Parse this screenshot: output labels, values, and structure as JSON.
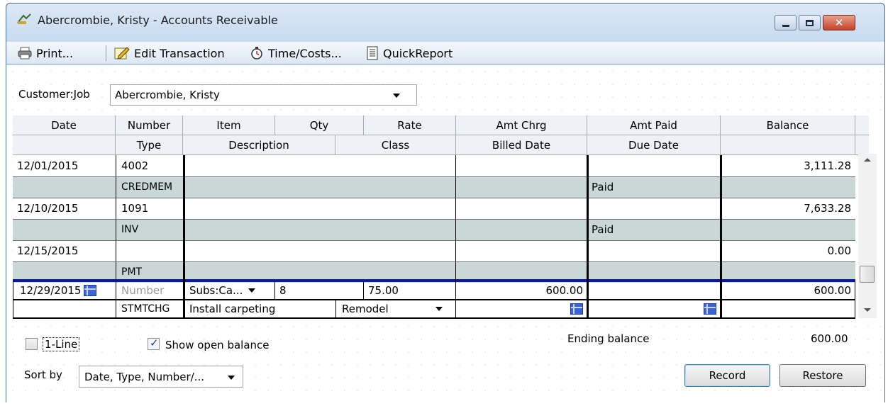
{
  "window": {
    "title": "Abercrombie, Kristy - Accounts Receivable"
  },
  "toolbar": {
    "print": "Print...",
    "edit": "Edit Transaction",
    "time": "Time/Costs...",
    "report": "QuickReport"
  },
  "customer_job": {
    "label": "Customer:Job",
    "value": "Abercrombie, Kristy"
  },
  "headers": {
    "row1": [
      "Date",
      "Number",
      "Item",
      "Qty",
      "Rate",
      "Amt Chrg",
      "Amt Paid",
      "Balance"
    ],
    "row2": [
      "Type",
      "Description",
      "Class",
      "Billed Date",
      "Due Date"
    ]
  },
  "transactions": [
    {
      "date": "12/01/2015",
      "number": "4002",
      "type": "CREDMEM",
      "paid": "Paid",
      "balance": "3,111.28"
    },
    {
      "date": "12/10/2015",
      "number": "1091",
      "type": "INV",
      "paid": "Paid",
      "balance": "7,633.28"
    },
    {
      "date": "12/15/2015",
      "number": "",
      "type": "PMT",
      "paid": "",
      "balance": "0.00"
    }
  ],
  "edit_row": {
    "date": "12/29/2015",
    "number_placeholder": "Number",
    "item": "Subs:Ca...",
    "qty": "8",
    "rate": "75.00",
    "amt_chrg": "600.00",
    "balance": "600.00",
    "type": "STMTCHG",
    "description": "Install carpeting",
    "class": "Remodel"
  },
  "footer": {
    "one_line": "1-Line",
    "show_open_balance": "Show open balance",
    "ending_balance_label": "Ending balance",
    "ending_balance_value": "600.00",
    "sort_by_label": "Sort by",
    "sort_by_value": "Date, Type, Number/...",
    "record": "Record",
    "restore": "Restore"
  }
}
